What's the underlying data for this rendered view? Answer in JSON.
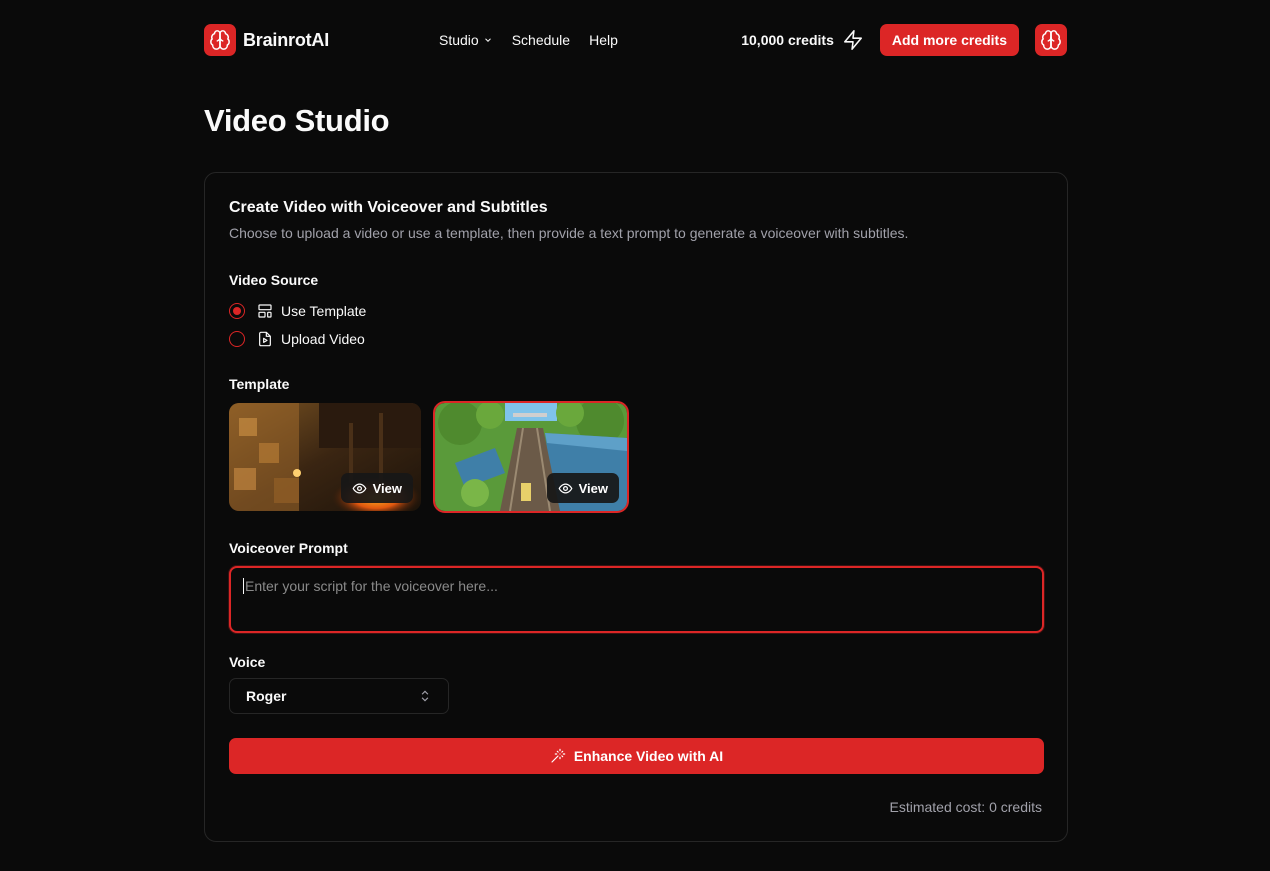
{
  "header": {
    "brand": "BrainrotAI",
    "nav": [
      {
        "label": "Studio",
        "has_dropdown": true
      },
      {
        "label": "Schedule"
      },
      {
        "label": "Help"
      }
    ],
    "credits": "10,000 credits",
    "add_credits_label": "Add more credits"
  },
  "page": {
    "title": "Video Studio"
  },
  "card": {
    "title": "Create Video with Voiceover and Subtitles",
    "description": "Choose to upload a video or use a template, then provide a text prompt to generate a voiceover with subtitles.",
    "video_source": {
      "label": "Video Source",
      "options": [
        {
          "label": "Use Template",
          "selected": true,
          "icon": "template-icon"
        },
        {
          "label": "Upload Video",
          "selected": false,
          "icon": "file-video-icon"
        }
      ]
    },
    "template": {
      "label": "Template",
      "items": [
        {
          "name": "minecraft-parkour",
          "view_label": "View",
          "selected": false
        },
        {
          "name": "subway-surfers",
          "view_label": "View",
          "selected": true
        }
      ]
    },
    "voiceover": {
      "label": "Voiceover Prompt",
      "placeholder": "Enter your script for the voiceover here...",
      "value": ""
    },
    "voice": {
      "label": "Voice",
      "selected": "Roger"
    },
    "enhance_label": "Enhance Video with AI",
    "estimated_cost": "Estimated cost: 0 credits"
  },
  "colors": {
    "accent": "#dc2626",
    "background": "#0a0a0a",
    "border": "#262626",
    "muted": "#a1a1aa"
  }
}
